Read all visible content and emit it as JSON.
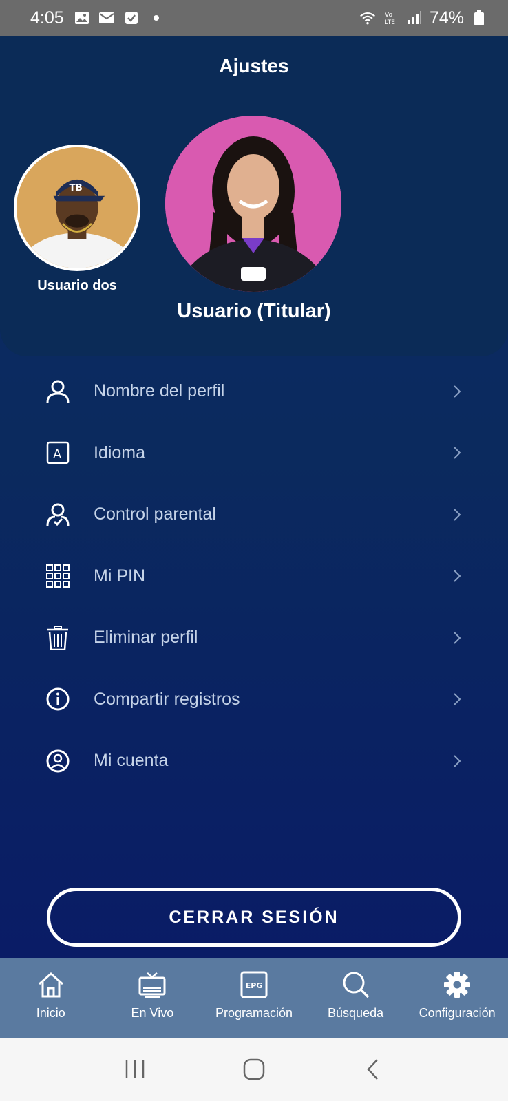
{
  "status_bar": {
    "time": "4:05",
    "battery": "74%",
    "icons": [
      "image-icon",
      "mail-icon",
      "check-icon",
      "dot-icon",
      "wifi-icon",
      "volte-icon",
      "signal-icon",
      "battery-icon"
    ]
  },
  "header": {
    "title": "Ajustes"
  },
  "profiles": {
    "secondary_name": "Usuario dos",
    "primary_name": "Usuario (Titular)"
  },
  "menu": {
    "items": [
      {
        "label": "Nombre del perfil",
        "icon": "user-icon"
      },
      {
        "label": "Idioma",
        "icon": "language-icon"
      },
      {
        "label": "Control parental",
        "icon": "parental-control-icon"
      },
      {
        "label": "Mi PIN",
        "icon": "pin-grid-icon"
      },
      {
        "label": "Eliminar perfil",
        "icon": "trash-icon"
      },
      {
        "label": "Compartir registros",
        "icon": "info-icon"
      },
      {
        "label": "Mi cuenta",
        "icon": "account-circle-icon"
      }
    ]
  },
  "logout": {
    "label": "CERRAR SESIÓN"
  },
  "bottom_nav": {
    "items": [
      {
        "label": "Inicio",
        "icon": "home-icon"
      },
      {
        "label": "En Vivo",
        "icon": "tv-icon"
      },
      {
        "label": "Programación",
        "icon": "epg-icon",
        "icon_text": "EPG"
      },
      {
        "label": "Búsqueda",
        "icon": "search-icon"
      },
      {
        "label": "Configuración",
        "icon": "gear-icon"
      }
    ]
  },
  "colors": {
    "header_bg": "#0b2b57",
    "body_bg": "#0a2262",
    "nav_bg": "#5a7aa0",
    "menu_text": "#c5d3e8"
  }
}
